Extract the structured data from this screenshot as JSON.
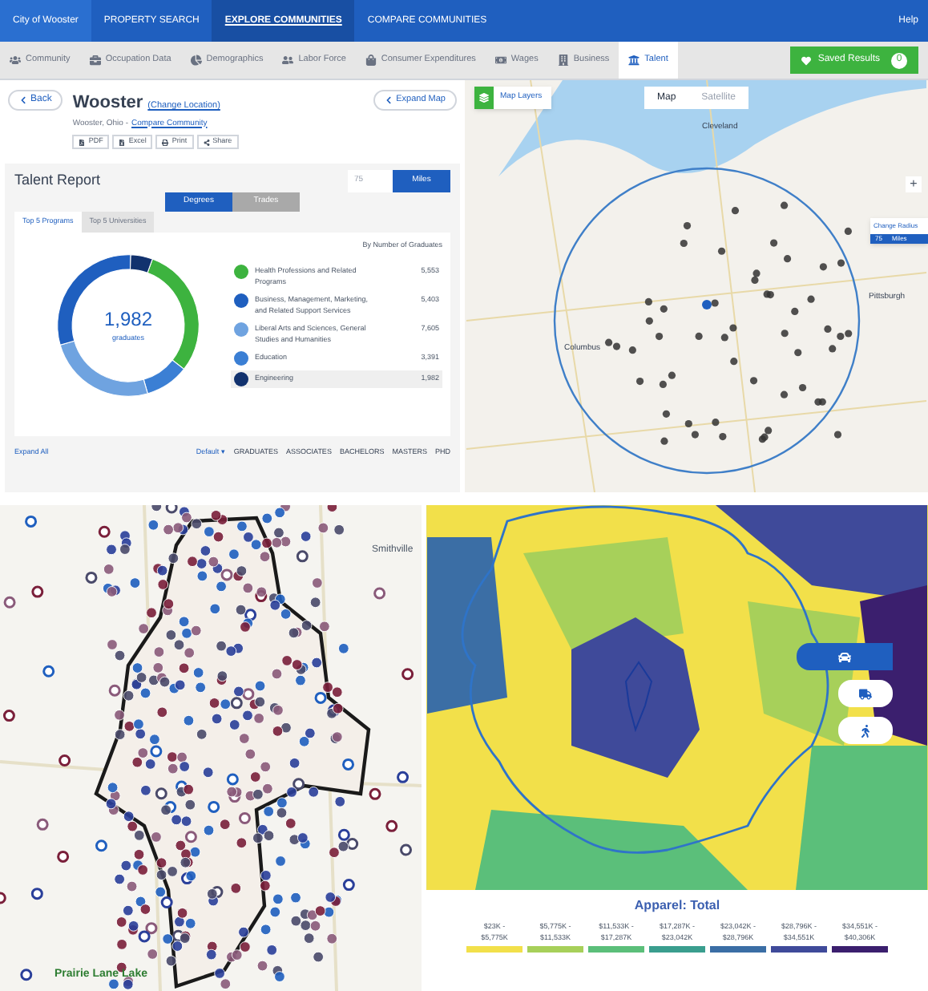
{
  "top_nav": {
    "items": [
      {
        "label": "City of Wooster",
        "selected": false
      },
      {
        "label": "PROPERTY SEARCH",
        "selected": false
      },
      {
        "label": "EXPLORE COMMUNITIES",
        "selected": true
      },
      {
        "label": "COMPARE COMMUNITIES",
        "selected": false
      }
    ],
    "help": "Help"
  },
  "sub_nav": {
    "tabs": [
      {
        "label": "Community",
        "selected": false
      },
      {
        "label": "Occupation Data",
        "selected": false
      },
      {
        "label": "Demographics",
        "selected": false
      },
      {
        "label": "Labor Force",
        "selected": false
      },
      {
        "label": "Consumer Expenditures",
        "selected": false
      },
      {
        "label": "Wages",
        "selected": false
      },
      {
        "label": "Business",
        "selected": false
      },
      {
        "label": "Talent",
        "selected": true
      }
    ],
    "saved_results": {
      "label": "Saved Results",
      "count": "0"
    }
  },
  "header": {
    "back": "Back",
    "title": "Wooster",
    "change_location": "(Change Location)",
    "subtitle": "Wooster, Ohio -",
    "compare_link": "Compare Community",
    "actions": [
      "PDF",
      "Excel",
      "Print",
      "Share"
    ],
    "expand_map": "Expand Map"
  },
  "talent_report": {
    "title": "Talent Report",
    "radius": "75",
    "unit": "Miles",
    "toggle": [
      {
        "label": "Degrees",
        "selected": true
      },
      {
        "label": "Trades",
        "selected": false
      }
    ],
    "tabs": [
      {
        "label": "Top 5 Programs",
        "selected": true
      },
      {
        "label": "Top 5 Universities",
        "selected": false
      }
    ],
    "sort_label": "By Number of Graduates",
    "center_value": "1,982",
    "center_label": "graduates",
    "programs": [
      {
        "name": "Health Professions and Related Programs",
        "count": "5,553",
        "color": "#3db33f",
        "selected": false
      },
      {
        "name": "Business, Management, Marketing, and Related Support Services",
        "count": "5,403",
        "color": "#1f5fbf",
        "selected": false
      },
      {
        "name": "Liberal Arts and Sciences, General Studies and Humanities",
        "count": "7,605",
        "color": "#6fa3e0",
        "selected": false
      },
      {
        "name": "Education",
        "count": "3,391",
        "color": "#3b7fd4",
        "selected": false
      },
      {
        "name": "Engineering",
        "count": "1,982",
        "color": "#12326e",
        "selected": true
      }
    ],
    "footer": {
      "expand_all": "Expand All",
      "default": "Default ▾",
      "levels": [
        "GRADUATES",
        "ASSOCIATES",
        "BACHELORS",
        "MASTERS",
        "PHD"
      ]
    }
  },
  "top_map": {
    "layers": "Map Layers",
    "modes": [
      {
        "label": "Map",
        "selected": true
      },
      {
        "label": "Satellite",
        "selected": false
      }
    ],
    "labels": [
      "Cleveland",
      "Columbus",
      "Pittsburgh"
    ],
    "zoom_in": "+",
    "radius_popup": {
      "title": "Change Radius",
      "value": "75",
      "unit": "Miles"
    }
  },
  "bottom_left_map": {
    "labels": [
      "Smithville",
      "Prairie Lane Lake"
    ]
  },
  "bottom_right_map": {
    "modes": [
      {
        "kind": "car",
        "selected": true
      },
      {
        "kind": "truck",
        "selected": false
      },
      {
        "kind": "walk",
        "selected": false
      }
    ],
    "legend": {
      "title": "Apparel: Total",
      "bins": [
        {
          "label": "$23K - $5,775K",
          "color": "#f2e04a"
        },
        {
          "label": "$5,775K - $11,533K",
          "color": "#a7d05a"
        },
        {
          "label": "$11,533K - $17,287K",
          "color": "#5bbf7a"
        },
        {
          "label": "$17,287K - $23,042K",
          "color": "#3a9e8e"
        },
        {
          "label": "$23,042K - $28,796K",
          "color": "#3b6ea5"
        },
        {
          "label": "$28,796K - $34,551K",
          "color": "#3f4a9a"
        },
        {
          "label": "$34,551K - $40,306K",
          "color": "#3b1f6e"
        }
      ]
    }
  }
}
